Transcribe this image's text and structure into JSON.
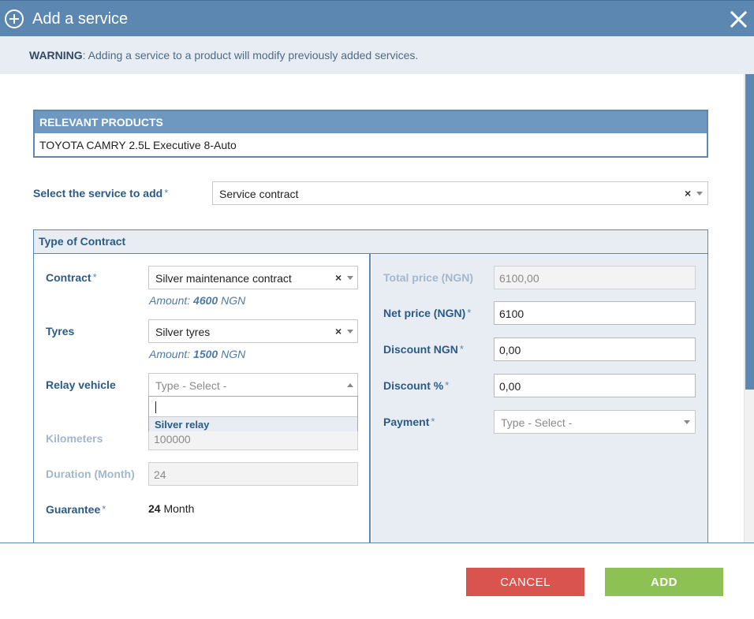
{
  "dialog": {
    "title": "Add a service"
  },
  "warning": {
    "label": "WARNING",
    "text": ": Adding a service to a product will modify previously added services."
  },
  "relevant_products": {
    "header": "RELEVANT PRODUCTS",
    "items": [
      "TOYOTA CAMRY 2.5L Executive 8-Auto"
    ]
  },
  "service_select": {
    "label": "Select the service to add",
    "required": "*",
    "value": "Service contract"
  },
  "type_of_contract": {
    "title": "Type of Contract",
    "contract": {
      "label": "Contract",
      "required": "*",
      "value": "Silver maintenance contract",
      "amount_prefix": "Amount: ",
      "amount_value": "4600",
      "amount_currency": " NGN"
    },
    "tyres": {
      "label": "Tyres",
      "value": "Silver tyres",
      "amount_prefix": "Amount: ",
      "amount_value": "1500",
      "amount_currency": " NGN"
    },
    "relay_vehicle": {
      "label": "Relay vehicle",
      "placeholder": "Type - Select -",
      "dropdown_option": "Silver relay"
    },
    "kilometers": {
      "label": "Kilometers",
      "value": "100000"
    },
    "duration": {
      "label": "Duration (Month)",
      "value": "24"
    },
    "guarantee": {
      "label": "Guarantee",
      "required": "*",
      "value": "24",
      "unit": " Month"
    },
    "total_price": {
      "label": "Total price (NGN)",
      "value": "6100,00"
    },
    "net_price": {
      "label": "Net price (NGN)",
      "required": "*",
      "value": "6100"
    },
    "discount_ngn": {
      "label": "Discount NGN",
      "required": "*",
      "value": "0,00"
    },
    "discount_pct": {
      "label": "Discount %",
      "required": "*",
      "value": "0,00"
    },
    "payment": {
      "label": "Payment",
      "required": "*",
      "placeholder": "Type - Select -"
    }
  },
  "buttons": {
    "cancel": "CANCEL",
    "add": "ADD"
  },
  "colors": {
    "header": "#5b87b1",
    "cancel": "#d9534f",
    "add": "#8dc153",
    "label": "#2c5a86"
  }
}
